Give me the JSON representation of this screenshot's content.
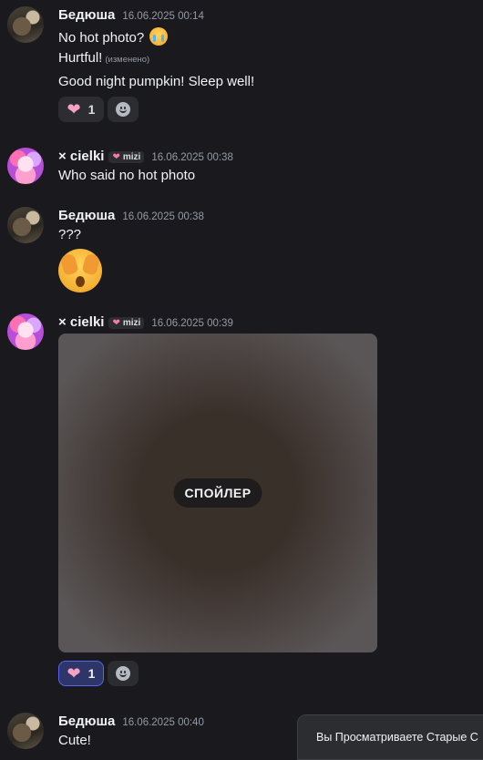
{
  "messages": [
    {
      "author": "Бедюша",
      "time": "16.06.2025 00:14",
      "lines": [
        "No hot photo?",
        "Hurtful!",
        "Good night pumpkin! Sleep well!"
      ],
      "edited": "(изменено)",
      "reaction": {
        "emoji": "heart",
        "count": "1"
      }
    },
    {
      "author": "× cielki",
      "tag": "mizi",
      "time": "16.06.2025 00:38",
      "lines": [
        "Who said no hot photo"
      ]
    },
    {
      "author": "Бедюша",
      "time": "16.06.2025 00:38",
      "lines": [
        "???"
      ],
      "big_emoji": "face-with-open-eyes-and-hand-over-mouth"
    },
    {
      "author": "× cielki",
      "tag": "mizi",
      "time": "16.06.2025 00:39",
      "spoiler_label": "СПОЙЛЕР",
      "reaction": {
        "emoji": "heart",
        "count": "1",
        "active": true
      }
    },
    {
      "author": "Бедюша",
      "time": "16.06.2025 00:40",
      "lines": [
        "Cute!"
      ]
    }
  ],
  "banner": {
    "text": "Вы Просматриваете Старые С"
  },
  "colors": {
    "background": "#1a1a1e",
    "accent": "#5865f2",
    "heart": "#f7a1c4"
  }
}
